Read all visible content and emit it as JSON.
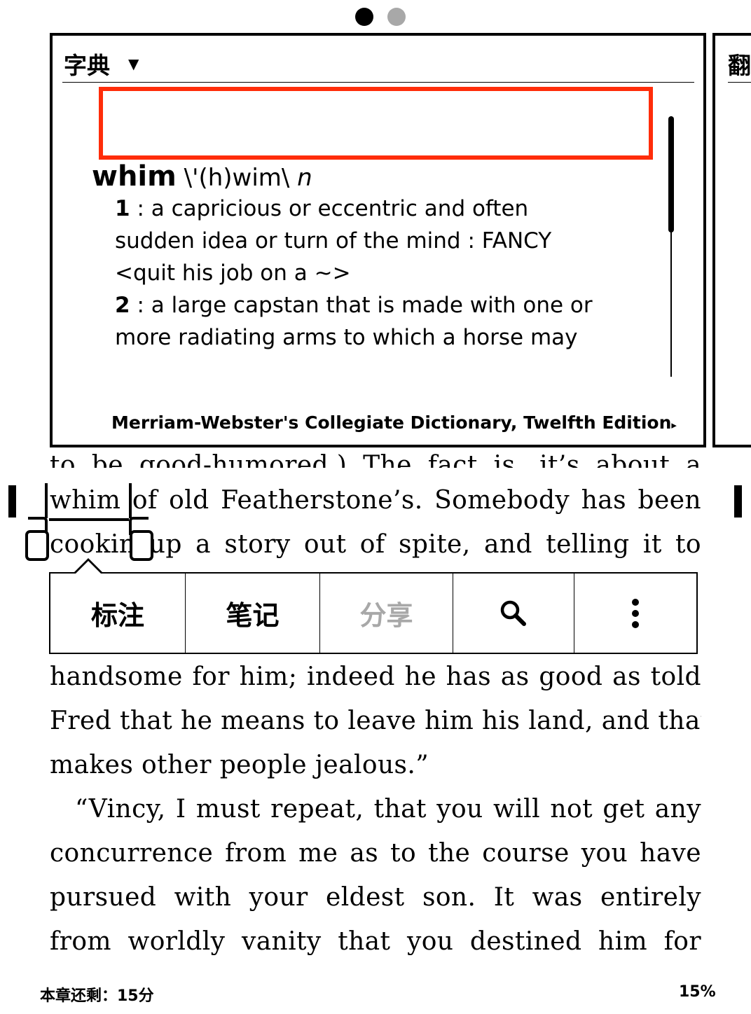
{
  "dictionary": {
    "title": "字典",
    "caret": "▼",
    "search_value": "",
    "headword": "whim",
    "pronunciation": "\\'(h)wim\\",
    "part_of_speech": "n",
    "definitions": [
      {
        "number": "1",
        "lines": [
          ": a capricious or eccentric and often",
          "sudden idea or turn of the mind : FANCY",
          "<quit his job on a  ~>"
        ]
      },
      {
        "number": "2",
        "lines": [
          ": a large capstan that is made with one or",
          "more radiating arms to which a horse may"
        ]
      }
    ],
    "source": "Merriam-Webster's Collegiate Dictionary, Twelfth Edition",
    "source_arrow": "▸"
  },
  "second_card": {
    "title": "翻"
  },
  "toolbar": {
    "highlight_label": "标注",
    "note_label": "笔记",
    "share_label": "分享",
    "search_icon": "search-icon",
    "more_icon": "more-vertical-icon"
  },
  "book": {
    "selected_word": "whim",
    "lines": {
      "cut_top": "to be good-humored.)  The fact is, it’s about a",
      "l1_rest": "of old Featherstone’s. Somebody has been",
      "l2": "cookin  up a story out of spite, and telling it to",
      "l3": "handsome for him; indeed he has as good as told",
      "l4": "Fred that he means to leave him his land, and that",
      "l5": "makes other people jealous.”",
      "l6": "“Vincy, I must repeat, that you will not get any",
      "l7": "concurrence from me as to the course you have",
      "l8": "pursued with your eldest son. It was entirely",
      "l9": "from worldly vanity that you destined him for"
    }
  },
  "footer": {
    "chapter_remaining": "本章还剩：15分",
    "progress": "15%"
  }
}
